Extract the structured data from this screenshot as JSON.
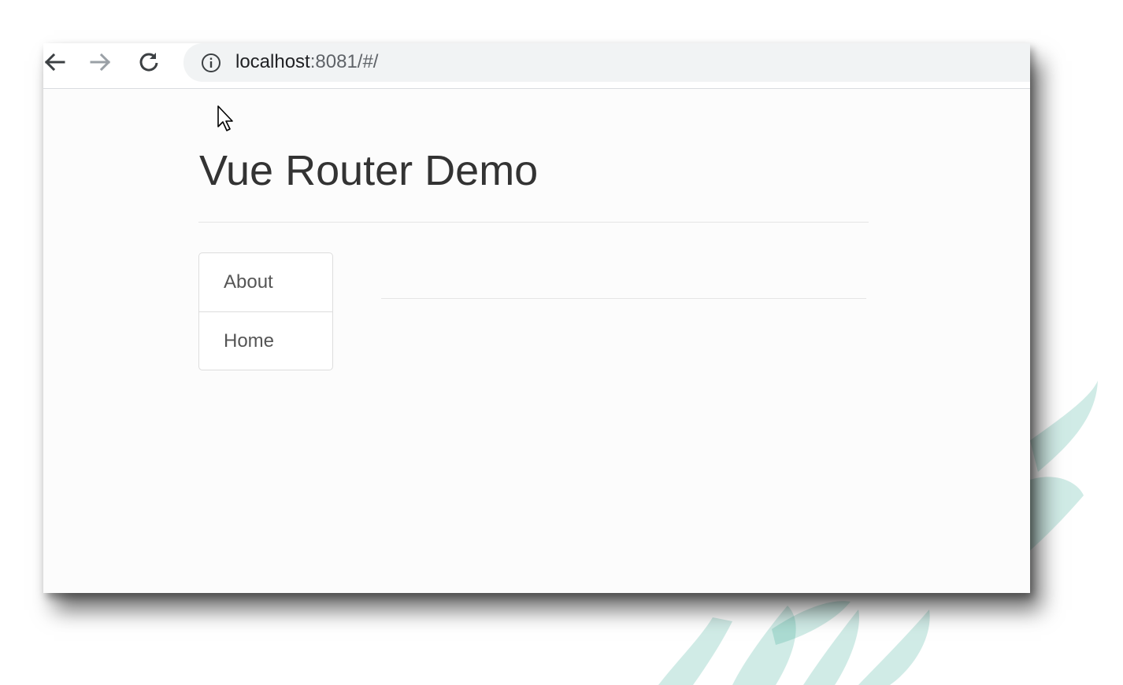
{
  "browser": {
    "back_icon": "arrow-left-icon",
    "forward_icon": "arrow-right-icon",
    "reload_icon": "reload-icon",
    "info_icon": "info-icon",
    "url_host": "localhost",
    "url_rest": ":8081/#/"
  },
  "page": {
    "title": "Vue Router Demo",
    "nav": [
      {
        "label": "About"
      },
      {
        "label": "Home"
      }
    ]
  },
  "colors": {
    "title_text": "#333333",
    "nav_text": "#555555",
    "omnibox_bg": "#f1f3f4",
    "watermark": "#2ba58c"
  }
}
